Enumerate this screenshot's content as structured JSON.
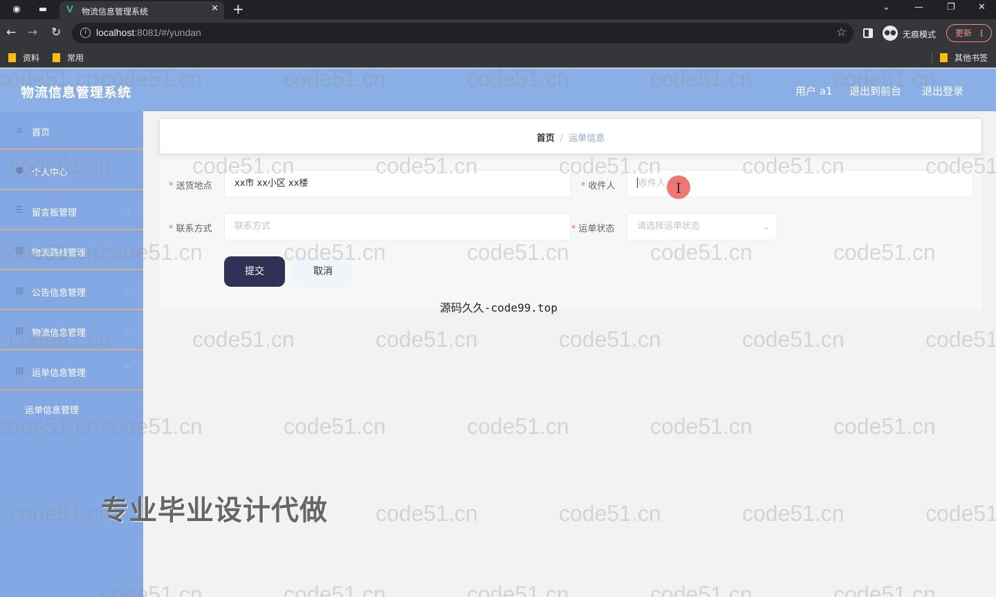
{
  "browser": {
    "tab_title": "物流信息管理系统",
    "tab_favicon": "V",
    "url_host": "localhost",
    "url_rest": ":8081/#/yundan",
    "incognito_label": "无痕模式",
    "update_label": "更新",
    "bookmarks": [
      "资料",
      "常用"
    ],
    "other_bookmarks": "其他书签"
  },
  "app": {
    "title": "物流信息管理系统",
    "user_label": "用户 a1",
    "back_to_front": "退出到前台",
    "logout": "退出登录"
  },
  "sidebar": {
    "items": [
      {
        "label": "首页",
        "icon": "home-icon"
      },
      {
        "label": "个人中心",
        "icon": "user-icon"
      },
      {
        "label": "留言板管理",
        "icon": "menu-icon"
      },
      {
        "label": "物流路线管理",
        "icon": "chart-icon"
      },
      {
        "label": "公告信息管理",
        "icon": "chart-icon"
      },
      {
        "label": "物流信息管理",
        "icon": "doc-icon"
      },
      {
        "label": "运单信息管理",
        "icon": "doc-icon"
      }
    ],
    "submenu": "运单信息管理"
  },
  "breadcrumb": {
    "home": "首页",
    "separator": "/",
    "current": "运单信息"
  },
  "form": {
    "address_label": "送货地点",
    "address_value": "xx市 xx小区 xx楼",
    "recipient_label": "收件人",
    "recipient_placeholder": "收件人",
    "contact_label": "联系方式",
    "contact_placeholder": "联系方式",
    "status_label": "运单状态",
    "status_placeholder": "请选择运单状态",
    "submit": "提交",
    "cancel": "取消"
  },
  "overlay": {
    "source": "源码久久-code99.top",
    "promo": "专业毕业设计代做",
    "watermark": "code51.cn"
  },
  "colors": {
    "header": "#8aaee6",
    "sidebar": "#84a8e3",
    "submit": "#2f3157",
    "required": "#f56c6c"
  }
}
